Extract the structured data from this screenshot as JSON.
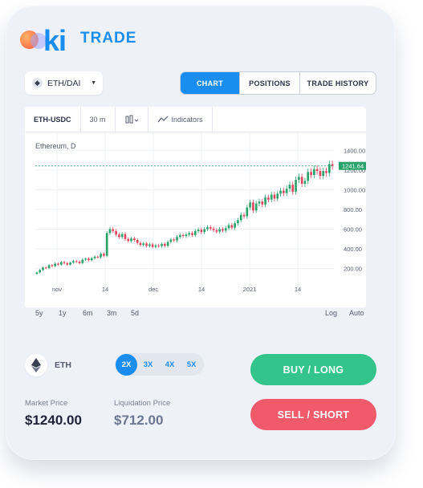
{
  "brand": {
    "logo_text": "ki",
    "name": "TRADE",
    "accent": "#1a8df0"
  },
  "pair_selector": {
    "label": "ETH/DAI"
  },
  "tabs": [
    {
      "label": "CHART"
    },
    {
      "label": "POSITIONS"
    },
    {
      "label": "TRADE HISTORY"
    }
  ],
  "chart": {
    "toolbar": {
      "symbol": "ETH-USDC",
      "interval": "30 m",
      "indicators": "Indicators"
    },
    "legend": "Ethereum,  D",
    "current_price_label": "1241.64",
    "ranges": [
      "5y",
      "1y",
      "6m",
      "3m",
      "5d"
    ],
    "right_controls": [
      "Log",
      "Auto"
    ]
  },
  "chart_data": {
    "type": "candlestick",
    "title": "Ethereum,  D",
    "x_ticks": [
      "nov",
      "14",
      "dec",
      "14",
      "2021",
      "14"
    ],
    "y_ticks": [
      "1400.00",
      "1200.00",
      "1000.00",
      "800.00",
      "600.00",
      "400.00",
      "200.00"
    ],
    "ylim": [
      50,
      1500
    ],
    "last_price": 1241.64,
    "up_color": "#2aa36b",
    "down_color": "#e0475f",
    "closes": [
      160,
      185,
      210,
      205,
      235,
      225,
      250,
      240,
      265,
      255,
      240,
      260,
      275,
      270,
      255,
      290,
      300,
      285,
      305,
      320,
      315,
      350,
      330,
      560,
      600,
      580,
      545,
      520,
      550,
      500,
      480,
      505,
      490,
      460,
      440,
      455,
      430,
      445,
      420,
      435,
      428,
      450,
      430,
      470,
      495,
      485,
      520,
      540,
      530,
      545,
      560,
      540,
      580,
      595,
      570,
      600,
      620,
      605,
      590,
      575,
      600,
      585,
      610,
      640,
      615,
      660,
      690,
      745,
      730,
      820,
      870,
      790,
      860,
      880,
      850,
      920,
      900,
      950,
      910,
      960,
      990,
      965,
      1010,
      1050,
      980,
      1100,
      1130,
      1060,
      1090,
      1180,
      1150,
      1210,
      1190,
      1140,
      1190,
      1170,
      1260,
      1241
    ]
  },
  "asset": {
    "symbol": "ETH"
  },
  "leverage": {
    "options": [
      "2X",
      "3X",
      "4X",
      "5X"
    ],
    "selected": "2X"
  },
  "actions": {
    "buy": "BUY / LONG",
    "sell": "SELL / SHORT"
  },
  "market_price": {
    "label": "Market Price",
    "value": "$1240.00"
  },
  "liquidation_price": {
    "label": "Liquidation Price",
    "value": "$712.00"
  }
}
